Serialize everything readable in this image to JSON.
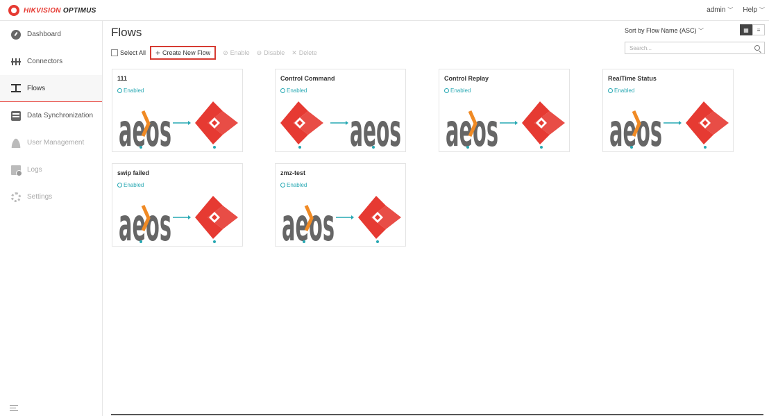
{
  "header": {
    "brand_primary": "HIKVISION",
    "brand_secondary": "OPTIMUS",
    "user": "admin",
    "help": "Help"
  },
  "sidebar": {
    "items": [
      {
        "label": "Dashboard",
        "icon": "dashboard-icon",
        "state": "normal"
      },
      {
        "label": "Connectors",
        "icon": "connectors-icon",
        "state": "normal"
      },
      {
        "label": "Flows",
        "icon": "flows-icon",
        "state": "active"
      },
      {
        "label": "Data Synchronization",
        "icon": "sync-icon",
        "state": "normal"
      },
      {
        "label": "User Management",
        "icon": "user-icon",
        "state": "disabled"
      },
      {
        "label": "Logs",
        "icon": "logs-icon",
        "state": "disabled"
      },
      {
        "label": "Settings",
        "icon": "settings-icon",
        "state": "disabled"
      }
    ]
  },
  "main": {
    "title": "Flows",
    "sort_label": "Sort by Flow Name (ASC)",
    "search_placeholder": "Search...",
    "toolbar": {
      "select_all": "Select All",
      "create": "Create New Flow",
      "enable": "Enable",
      "disable": "Disable",
      "delete": "Delete"
    },
    "flows": [
      {
        "name": "111",
        "status": "Enabled"
      },
      {
        "name": "Control Command",
        "status": "Enabled"
      },
      {
        "name": "Control Replay",
        "status": "Enabled"
      },
      {
        "name": "RealTime Status",
        "status": "Enabled"
      },
      {
        "name": "swip failed",
        "status": "Enabled"
      },
      {
        "name": "zmz-test",
        "status": "Enabled"
      }
    ]
  },
  "colors": {
    "accent": "#e63a32",
    "enabled": "#27a8b3",
    "source_logo": "#666666"
  }
}
